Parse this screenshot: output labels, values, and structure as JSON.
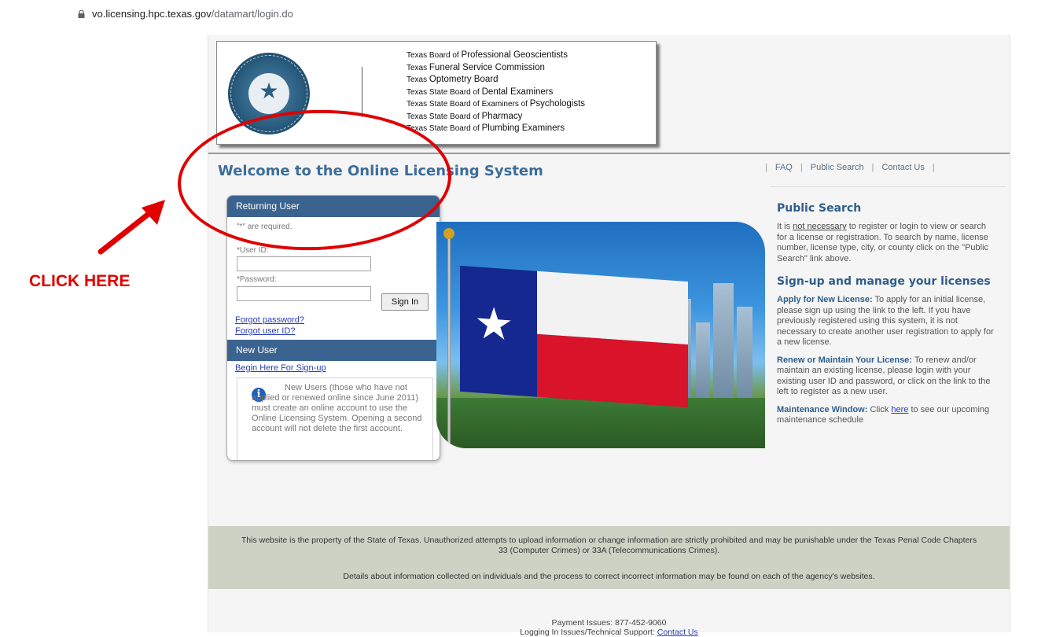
{
  "browser": {
    "url_host": "vo.licensing.hpc.texas.gov",
    "url_path": "/datamart/login.do"
  },
  "banner": {
    "boards": [
      {
        "prefix": "Texas Board of ",
        "name": "Professional Geoscientists"
      },
      {
        "prefix": "Texas ",
        "name": "Funeral Service Commission"
      },
      {
        "prefix": "Texas ",
        "name": "Optometry Board"
      },
      {
        "prefix": "Texas State Board of ",
        "name": "Dental Examiners"
      },
      {
        "prefix": "Texas State Board of Examiners of ",
        "name": "Psychologists"
      },
      {
        "prefix": "Texas State Board of ",
        "name": "Pharmacy"
      },
      {
        "prefix": "Texas State Board of ",
        "name": "Plumbing Examiners"
      }
    ]
  },
  "header": {
    "welcome": "Welcome to the Online Licensing System",
    "links": {
      "faq": "FAQ",
      "public_search": "Public Search",
      "contact": "Contact Us"
    }
  },
  "login": {
    "returning_title": "Returning User",
    "required_note": "\"*\" are required.",
    "user_id_label": "*User ID:",
    "user_id_value": "",
    "password_label": "*Password:",
    "password_value": "",
    "sign_in": "Sign In",
    "forgot_password": "Forgot password?",
    "forgot_user_id": "Forgot user ID?",
    "new_user_title": "New User",
    "sign_up_link": "Begin Here For Sign-up",
    "new_user_info": "New Users (those who have not applied or renewed online since June 2011) must create an online account to use the Online Licensing System. Opening a second account will not delete the first account."
  },
  "right": {
    "public_search_title": "Public Search",
    "ps_text_1": "It is ",
    "ps_not_necessary": "not necessary",
    "ps_text_2": " to register or login to view or search for a license or registration. To search by name, license number, license type, city, or county click on the \"Public Search\" link above.",
    "signup_title": "Sign-up and manage your licenses",
    "apply_label": "Apply for New License:",
    "apply_text": " To apply for an initial license, please sign up using the link to the left. If you have previously registered using this system, it is not necessary to create another user registration to apply for a new license.",
    "renew_label": "Renew or Maintain Your License:",
    "renew_text": " To renew and/or maintain an existing license, please login with your existing user ID and password, or click on the link to the left to register as a new user.",
    "maint_label": "Maintenance Window:",
    "maint_text_1": " Click ",
    "maint_here": "here",
    "maint_text_2": " to see our upcoming maintenance schedule"
  },
  "disclaimer": {
    "line1": "This website is the property of the State of Texas. Unauthorized attempts to upload information or change information are strictly prohibited and may be punishable under the Texas Penal Code Chapters 33 (Computer Crimes) or 33A (Telecommunications Crimes).",
    "line2": "Details about information collected on individuals and the process to correct incorrect information may be found on each of the agency's websites."
  },
  "footer": {
    "payment": "Payment Issues: 877-452-9060",
    "support_label": "Logging In Issues/Technical Support: ",
    "support_link": "Contact Us"
  },
  "annotation": {
    "click_here": "CLICK HERE",
    "color": "#e00000"
  }
}
